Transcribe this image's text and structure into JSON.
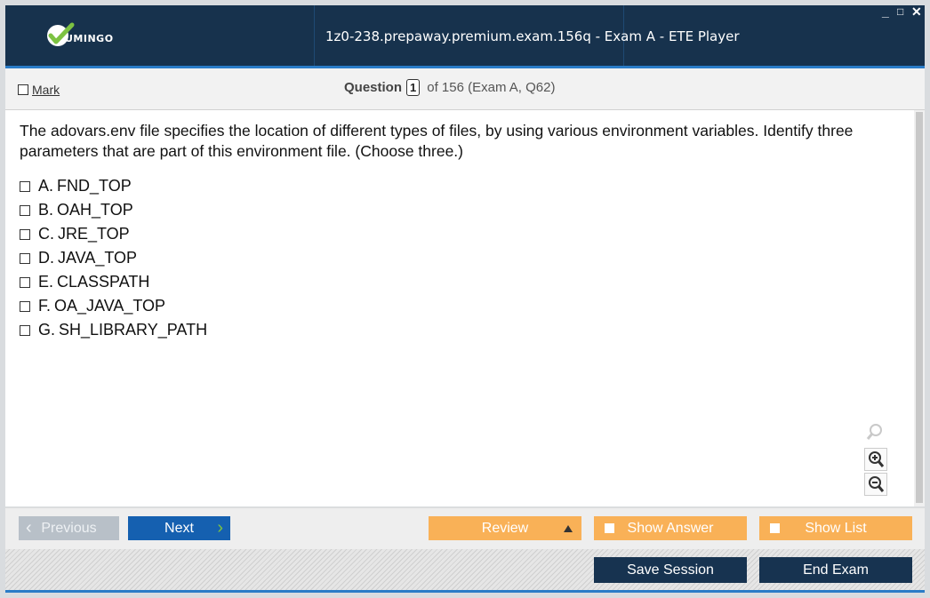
{
  "window": {
    "title": "1z0-238.prepaway.premium.exam.156q - Exam A - ETE Player",
    "logo_text": "UMINGO",
    "controls": {
      "minimize": "_",
      "maximize": "□",
      "close": "✕"
    }
  },
  "header": {
    "mark_label": "Mark",
    "question_label": "Question",
    "question_number": "1",
    "question_total": "of 156 (Exam A, Q62)"
  },
  "question": {
    "text": "The adovars.env file specifies the location of different types of files, by using various environment variables. Identify three parameters that are part of this environment file. (Choose three.)",
    "options": [
      {
        "letter": "A.",
        "text": "FND_TOP"
      },
      {
        "letter": "B.",
        "text": "OAH_TOP"
      },
      {
        "letter": "C.",
        "text": "JRE_TOP"
      },
      {
        "letter": "D.",
        "text": "JAVA_TOP"
      },
      {
        "letter": "E.",
        "text": "CLASSPATH"
      },
      {
        "letter": "F.",
        "text": "OA_JAVA_TOP"
      },
      {
        "letter": "G.",
        "text": "SH_LIBRARY_PATH"
      }
    ]
  },
  "nav": {
    "previous": "Previous",
    "next": "Next",
    "review": "Review",
    "show_answer": "Show Answer",
    "show_list": "Show List"
  },
  "footer": {
    "save_session": "Save Session",
    "end_exam": "End Exam"
  },
  "colors": {
    "titlebar": "#17324d",
    "accent_blue": "#1560b0",
    "orange": "#f9b157",
    "dark_button": "#173350",
    "logo_green": "#7cc242"
  }
}
